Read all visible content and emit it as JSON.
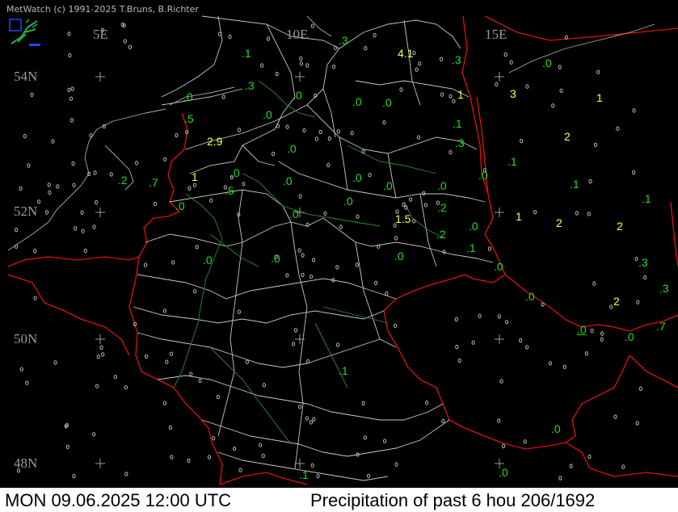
{
  "app": {
    "credit": "MetWatch  (c) 1991-2025 T.Bruns, B.Richter",
    "logo_icon": "metwatch-logo-icon"
  },
  "map": {
    "title": "Precipitation of past  6 hou",
    "region": "Germany",
    "coordinate_labels": {
      "lon": [
        "5E",
        "10E",
        "15E"
      ],
      "lat": [
        "54N",
        "52N",
        "50N",
        "48N"
      ]
    },
    "colors": {
      "background": "#000000",
      "borders": "#e01010",
      "states": "#c8c8c8",
      "rivers": "#2e8b2e",
      "value_low": "#22dd22",
      "value_high": "#ffff44",
      "station_marker": "#bbbbbb"
    },
    "observations": [
      {
        "value": ".1",
        "color": "green"
      },
      {
        "value": ".3",
        "color": "green"
      },
      {
        "value": "4.1",
        "color": "yellow"
      },
      {
        "value": ".3",
        "color": "green"
      },
      {
        "value": ".0",
        "color": "green"
      },
      {
        "value": ".0",
        "color": "green"
      },
      {
        "value": ".3",
        "color": "green"
      },
      {
        "value": ".0",
        "color": "green"
      },
      {
        "value": ".0",
        "color": "green"
      },
      {
        "value": ".0",
        "color": "green"
      },
      {
        "value": "1",
        "color": "yellow"
      },
      {
        "value": "3",
        "color": "yellow"
      },
      {
        "value": "1",
        "color": "yellow"
      },
      {
        "value": ".5",
        "color": "green"
      },
      {
        "value": ".0",
        "color": "green"
      },
      {
        "value": ".1",
        "color": "green"
      },
      {
        "value": "2",
        "color": "yellow"
      },
      {
        "value": "2.9",
        "color": "yellow"
      },
      {
        "value": ".0",
        "color": "green"
      },
      {
        "value": ".3",
        "color": "green"
      },
      {
        "value": ".1",
        "color": "green"
      },
      {
        "value": "1",
        "color": "yellow"
      },
      {
        "value": ".0",
        "color": "green"
      },
      {
        "value": ".0",
        "color": "green"
      },
      {
        "value": ".0",
        "color": "green"
      },
      {
        "value": ".0",
        "color": "green"
      },
      {
        "value": ".2",
        "color": "green"
      },
      {
        "value": ".7",
        "color": "green"
      },
      {
        "value": ".5",
        "color": "green"
      },
      {
        "value": ".1",
        "color": "green"
      },
      {
        "value": ".0",
        "color": "green"
      },
      {
        "value": ".0",
        "color": "green"
      },
      {
        "value": ".1",
        "color": "green"
      },
      {
        "value": ".0",
        "color": "green"
      },
      {
        "value": ".0",
        "color": "green"
      },
      {
        "value": ".2",
        "color": "green"
      },
      {
        "value": "1.5",
        "color": "yellow"
      },
      {
        "value": "1",
        "color": "yellow"
      },
      {
        "value": "2",
        "color": "yellow"
      },
      {
        "value": "2",
        "color": "yellow"
      },
      {
        "value": ".0",
        "color": "green"
      },
      {
        "value": ".2",
        "color": "green"
      },
      {
        "value": ".1",
        "color": "green"
      },
      {
        "value": ".0",
        "color": "green"
      },
      {
        "value": ".0",
        "color": "green"
      },
      {
        "value": ".0",
        "color": "green"
      },
      {
        "value": ".0",
        "color": "green"
      },
      {
        "value": ".3",
        "color": "green"
      },
      {
        "value": ".0",
        "color": "green"
      },
      {
        "value": ".3",
        "color": "green"
      },
      {
        "value": "2",
        "color": "yellow"
      },
      {
        "value": ".0",
        "color": "green"
      },
      {
        "value": ".0",
        "color": "green"
      },
      {
        "value": ".7",
        "color": "green"
      },
      {
        "value": ".1",
        "color": "green"
      },
      {
        "value": ".0",
        "color": "green"
      },
      {
        "value": ".0",
        "color": "green"
      },
      {
        "value": ".1",
        "color": "green"
      },
      {
        "value": ".0",
        "color": "green"
      }
    ]
  },
  "status": {
    "datetime": "MON 09.06.2025 12:00 UTC",
    "product": "Precipitation of past  6 hou 206/1692"
  }
}
